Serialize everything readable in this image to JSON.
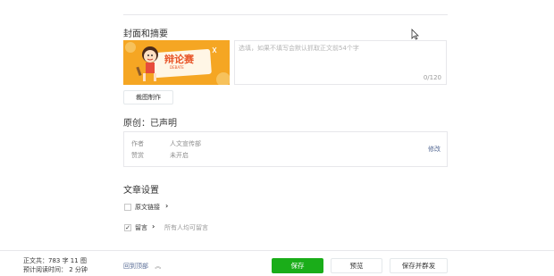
{
  "cover": {
    "section_title": "封面和摘要",
    "image_text": "辩论赛",
    "image_subtext": "DEBATE",
    "summary_placeholder": "选填，如果不填写会默认抓取正文前54个字",
    "summary_count": "0/120",
    "crop_button": "裁图制作"
  },
  "original": {
    "section_title": "原创：已声明",
    "author_label": "作者",
    "author_value": "人文宣传部",
    "reward_label": "赞赏",
    "reward_value": "未开启",
    "edit_link": "修改"
  },
  "settings": {
    "section_title": "文章设置",
    "original_link": {
      "label": "原文链接",
      "checked": false
    },
    "comments": {
      "label": "留言",
      "checked": true,
      "hint": "所有人均可留言"
    }
  },
  "footer": {
    "word_count": "正文共：783 字 11 图",
    "read_time": "预计阅读时间： 2 分钟",
    "back_to_top": "回到顶部",
    "save": "保存",
    "preview": "预览",
    "save_and_send": "保存并群发"
  },
  "colors": {
    "primary_green": "#1aad19",
    "link": "#576b95",
    "cover_bg": "#f5a623"
  }
}
